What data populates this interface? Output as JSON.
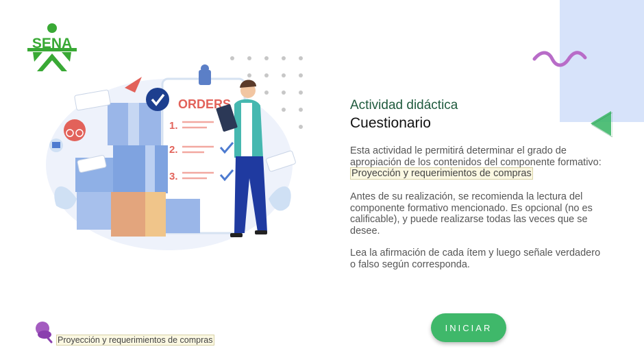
{
  "brand": {
    "logo_text": "SENA"
  },
  "header": {
    "activity_type": "Actividad didáctica",
    "activity_name": "Cuestionario"
  },
  "body": {
    "p1_text": "Esta actividad le permitirá determinar el grado de apropiación de los contenidos del componente formativo: ",
    "p1_highlight": "Proyección y requerimientos de compras",
    "p2_text": "Antes de su realización, se recomienda la lectura del componente formativo mencionado. Es opcional (no es calificable), y puede realizarse todas las veces que se desee.",
    "p3_text": "Lea la afirmación de cada ítem y luego señale verdadero o falso según corresponda."
  },
  "actions": {
    "start_label": "INICIAR"
  },
  "footer": {
    "component_link": "Proyección y requerimientos de compras"
  },
  "illustration": {
    "board_title": "ORDERS",
    "list_numbers": [
      "1.",
      "2.",
      "3."
    ]
  },
  "colors": {
    "brand_green": "#39a935",
    "accent_green": "#3fb86a",
    "title_green": "#1f5a3d",
    "deco_blue": "#d7e3fa",
    "wave_purple": "#b86cc8",
    "highlight_bg": "#fbf8e2"
  }
}
